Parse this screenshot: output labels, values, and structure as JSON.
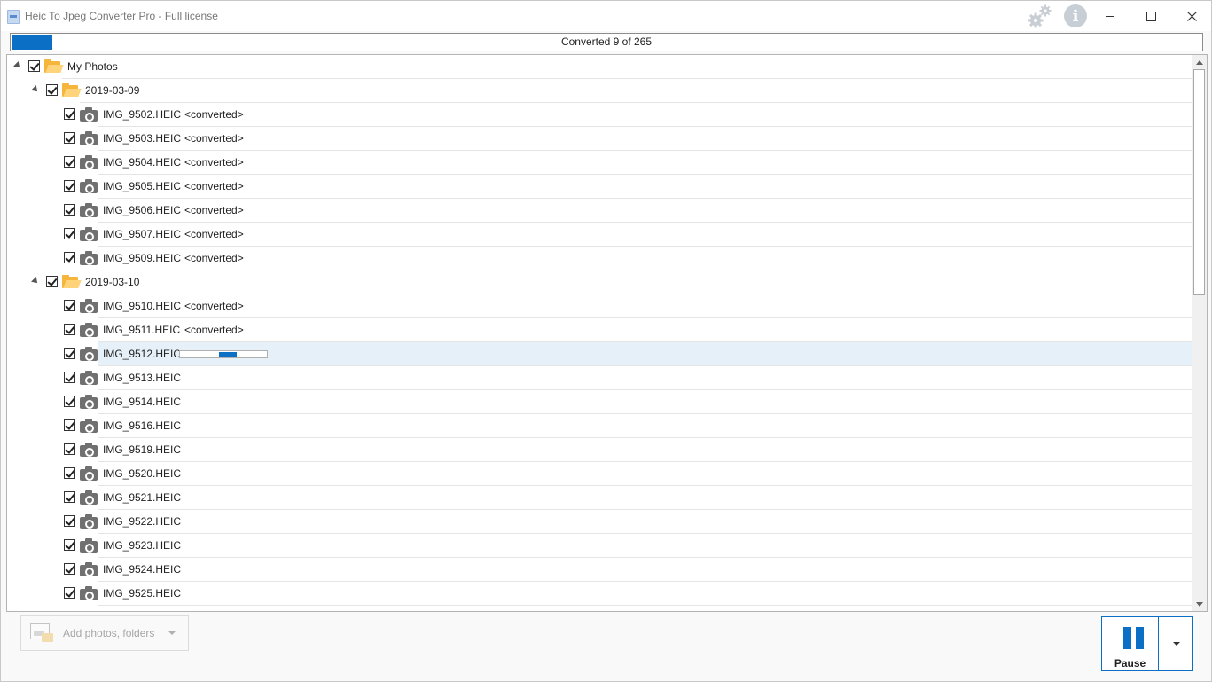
{
  "window": {
    "title": "Heic To Jpeg Converter Pro - Full license",
    "icons": [
      "app-icon",
      "gear-icon",
      "info-icon",
      "minimize-icon",
      "maximize-icon",
      "close-icon"
    ]
  },
  "progress": {
    "text": "Converted 9 of 265",
    "converted": 9,
    "total": 265,
    "color": "#0c6fc6"
  },
  "tree": {
    "root": {
      "label": "My Photos",
      "checked": true,
      "expanded": true
    },
    "folder1": {
      "label": "2019-03-09",
      "checked": true,
      "expanded": true,
      "files": [
        {
          "name": "IMG_9502.HEIC",
          "status": "<converted>"
        },
        {
          "name": "IMG_9503.HEIC",
          "status": "<converted>"
        },
        {
          "name": "IMG_9504.HEIC",
          "status": "<converted>"
        },
        {
          "name": "IMG_9505.HEIC",
          "status": "<converted>"
        },
        {
          "name": "IMG_9506.HEIC",
          "status": "<converted>"
        },
        {
          "name": "IMG_9507.HEIC",
          "status": "<converted>"
        },
        {
          "name": "IMG_9509.HEIC",
          "status": "<converted>"
        }
      ]
    },
    "folder2": {
      "label": "2019-03-10",
      "checked": true,
      "expanded": true,
      "files": [
        {
          "name": "IMG_9510.HEIC",
          "status": "<converted>"
        },
        {
          "name": "IMG_9511.HEIC",
          "status": "<converted>"
        },
        {
          "name": "IMG_9512.HEIC",
          "status": "",
          "in_progress": true,
          "selected": true
        },
        {
          "name": "IMG_9513.HEIC",
          "status": ""
        },
        {
          "name": "IMG_9514.HEIC",
          "status": ""
        },
        {
          "name": "IMG_9516.HEIC",
          "status": ""
        },
        {
          "name": "IMG_9519.HEIC",
          "status": ""
        },
        {
          "name": "IMG_9520.HEIC",
          "status": ""
        },
        {
          "name": "IMG_9521.HEIC",
          "status": ""
        },
        {
          "name": "IMG_9522.HEIC",
          "status": ""
        },
        {
          "name": "IMG_9523.HEIC",
          "status": ""
        },
        {
          "name": "IMG_9524.HEIC",
          "status": ""
        },
        {
          "name": "IMG_9525.HEIC",
          "status": ""
        }
      ]
    },
    "icons": [
      "expander-icon",
      "checkbox-icon",
      "folder-open-icon",
      "camera-icon"
    ],
    "selected_row_color": "#e5f0f8"
  },
  "footer": {
    "add_button_label": "Add photos, folders",
    "add_button_enabled": false,
    "pause_button_label": "Pause",
    "icons": [
      "add-photos-icon",
      "chevron-down-icon",
      "pause-icon",
      "dropdown-arrow-icon"
    ]
  }
}
